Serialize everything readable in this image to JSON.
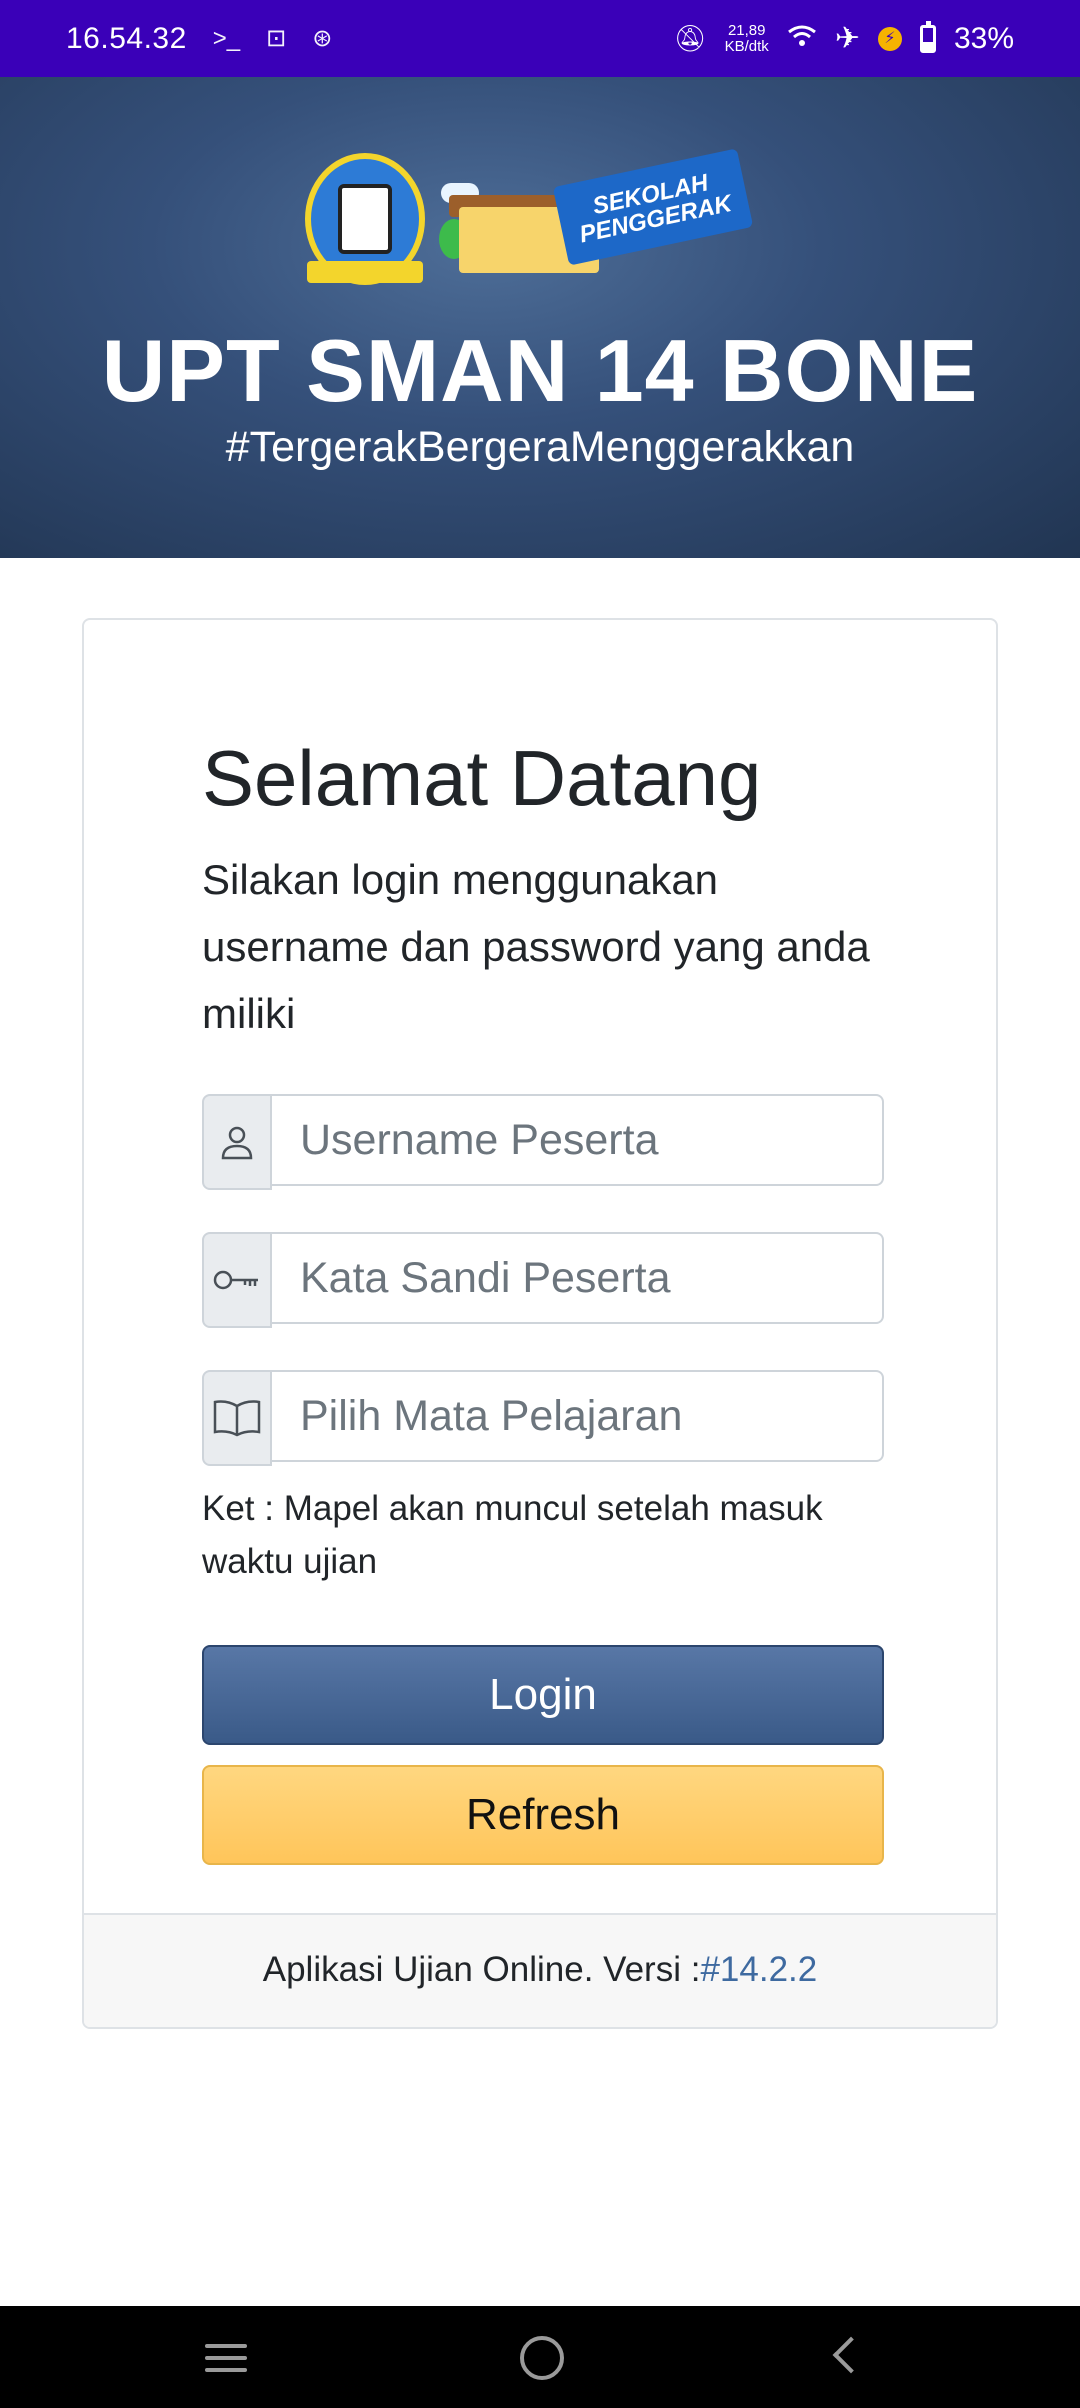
{
  "status_bar": {
    "time": "16.54.32",
    "speed_value": "21,89",
    "speed_unit": "KB/dtk",
    "battery": "33%",
    "battery_level": 0.33
  },
  "header": {
    "title": "UPT SMAN 14 BONE",
    "tagline": "#TergerakBergeraMenggerakkan",
    "logo_text": "SEKOLAH PENGGERAK",
    "banner_color": "#35507a"
  },
  "login": {
    "heading": "Selamat Datang",
    "subtext": "Silakan login menggunakan username dan password yang anda miliki",
    "username_placeholder": "Username Peserta",
    "password_placeholder": "Kata Sandi Peserta",
    "subject_placeholder": "Pilih Mata Pelajaran",
    "note": "Ket : Mapel akan muncul setelah masuk waktu ujian",
    "login_label": "Login",
    "refresh_label": "Refresh"
  },
  "footer": {
    "text": "Aplikasi Ujian Online. Versi :",
    "version": "#14.2.2"
  },
  "icons": {
    "username": "user-icon",
    "password": "key-icon",
    "subject": "book-icon"
  },
  "colors": {
    "status_bar": "#3a00b8",
    "login_button": "#3a5a88",
    "refresh_button": "#ffc55a",
    "version_link": "#3e6aa0"
  }
}
